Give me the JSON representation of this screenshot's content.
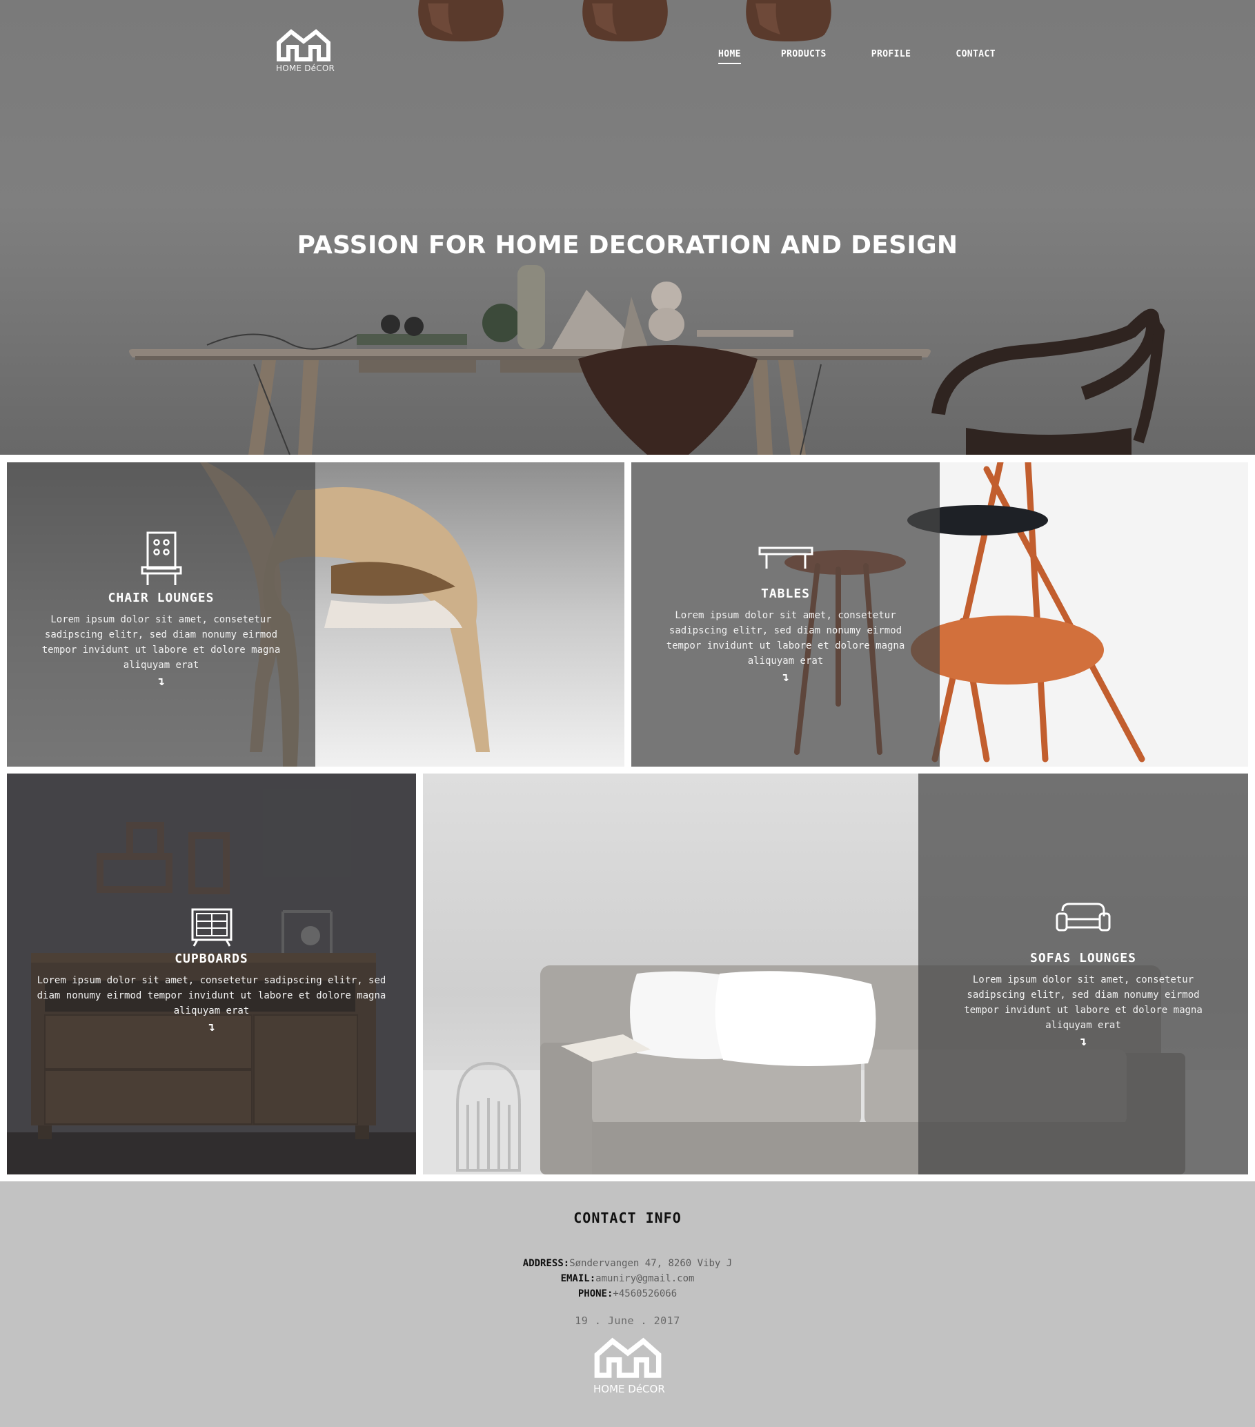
{
  "brand": {
    "name": "HOME DéCOR"
  },
  "nav": {
    "items": [
      {
        "label": "HOME",
        "active": true
      },
      {
        "label": "PRODUCTS"
      },
      {
        "label": "PROFILE"
      },
      {
        "label": "CONTACT"
      }
    ]
  },
  "hero": {
    "title": "PASSION FOR HOME DECORATION AND DESIGN"
  },
  "tiles": {
    "chairs": {
      "title": "CHAIR LOUNGES",
      "text": "Lorem ipsum dolor sit amet, consetetur sadipscing elitr, sed diam nonumy eirmod tempor invidunt ut labore et dolore magna aliquyam erat",
      "arrow": "↴",
      "icon": "chair-icon"
    },
    "tables": {
      "title": "TABLES",
      "text": "Lorem ipsum dolor sit amet, consetetur sadipscing elitr, sed diam nonumy eirmod tempor invidunt ut labore et dolore magna aliquyam erat",
      "arrow": "↴",
      "icon": "table-icon"
    },
    "cupboards": {
      "title": "CUPBOARDS",
      "text": "Lorem ipsum dolor sit amet, consetetur sadipscing elitr, sed diam nonumy eirmod tempor invidunt ut labore et dolore magna aliquyam erat",
      "arrow": "↴",
      "icon": "cupboard-icon"
    },
    "sofas": {
      "title": "SOFAS LOUNGES",
      "text": "Lorem ipsum dolor sit amet, consetetur sadipscing elitr, sed diam nonumy eirmod tempor invidunt ut labore et dolore magna aliquyam erat",
      "arrow": "↴",
      "icon": "sofa-icon"
    }
  },
  "footer": {
    "title": "CONTACT INFO",
    "address_label": "ADDRESS:",
    "address": "Søndervangen 47, 8260 Viby J",
    "email_label": "EMAIL:",
    "email": "amuniry@gmail.com",
    "phone_label": "PHONE:",
    "phone": "+4560526066",
    "date": "19 . June . 2017"
  },
  "colors": {
    "hero_bg": "#7d7d7d",
    "overlay": "#464646",
    "footer_bg": "#c2c2c2",
    "text_light": "#ffffff"
  }
}
